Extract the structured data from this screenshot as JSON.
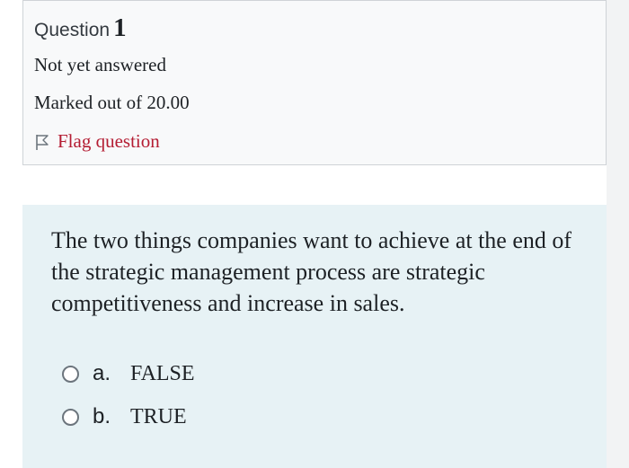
{
  "info": {
    "question_label": "Question",
    "question_number": "1",
    "state": "Not yet answered",
    "grade": "Marked out of 20.00",
    "flag_label": "Flag question",
    "flag_icon": "flag-outline-icon"
  },
  "question": {
    "text": "The two things companies want to achieve at the end of the strategic management process are strategic competitiveness and increase in sales.",
    "options": [
      {
        "letter": "a.",
        "label": "FALSE",
        "selected": false
      },
      {
        "letter": "b.",
        "label": "TRUE",
        "selected": false
      }
    ]
  },
  "colors": {
    "info_background": "#f8f9fa",
    "content_background": "#e7f2f5",
    "flag_text": "#b41d33"
  }
}
